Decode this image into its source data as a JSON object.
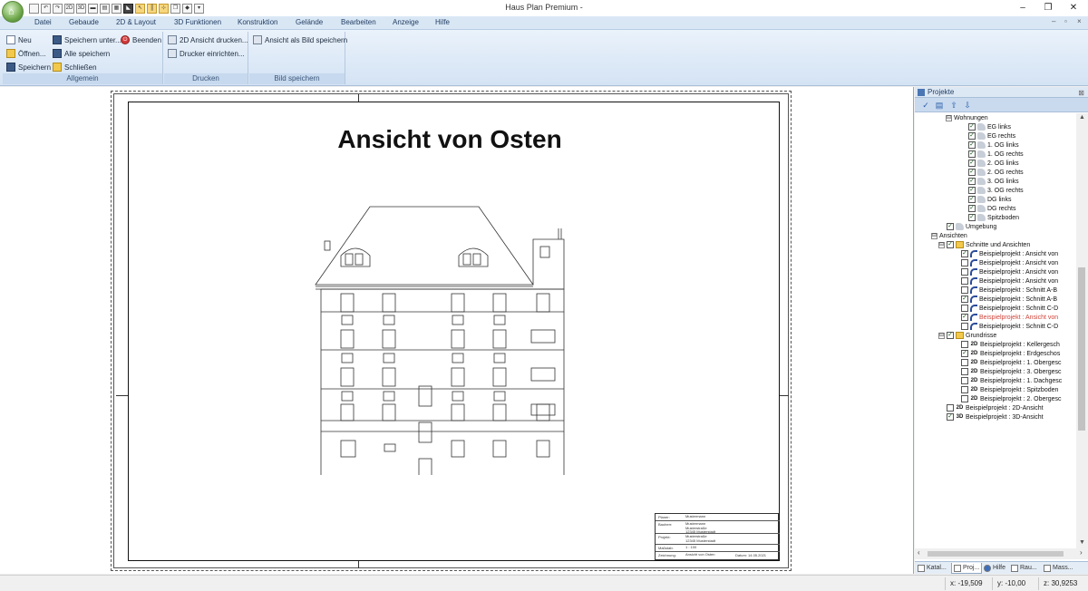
{
  "window": {
    "title": "Haus Plan Premium -",
    "buttons": {
      "minimize": "–",
      "maximize": "❐",
      "close": "✕"
    }
  },
  "quick_access": [
    "new-doc-icon",
    "undo-icon",
    "redo-icon",
    "view-2d-icon",
    "view-3d-icon",
    "wall-icon",
    "layer-icon",
    "stairs-icon",
    "roof-icon",
    "select-arrow-icon",
    "measure-icon",
    "copy-icon",
    "paint-icon",
    "dropdown-icon"
  ],
  "menu": {
    "items": [
      "Datei",
      "Gebaude",
      "2D & Layout",
      "3D Funktionen",
      "Konstruktion",
      "Gelände",
      "Bearbeiten",
      "Anzeige",
      "Hilfe"
    ],
    "mdi_buttons": [
      "–",
      "▫",
      "×"
    ]
  },
  "ribbon": {
    "groups": [
      {
        "caption": "Allgemein",
        "items": [
          "Neu",
          "Öffnen...",
          "Speichern",
          "Speichern unter...",
          "Alle speichern",
          "Schließen",
          "Beenden"
        ]
      },
      {
        "caption": "Drucken",
        "items": [
          "2D Ansicht drucken...",
          "Drucker einrichten..."
        ]
      },
      {
        "caption": "Bild speichern",
        "items": [
          "Ansicht als Bild speichern"
        ]
      }
    ]
  },
  "drawing": {
    "title": "Ansicht von Osten",
    "title_block": {
      "rows": [
        {
          "key": "Planer:",
          "value": "Mustermann",
          "value2": ""
        },
        {
          "key": "Bauherr:",
          "value": "Mustermann\nMusterstraße\n12345 Musterstadt",
          "value2": ""
        },
        {
          "key": "Projekt:",
          "value": "Musterstraße\n12345 Musterstadt",
          "value2": ""
        },
        {
          "key": "Maßstab:",
          "value": "1 : 100",
          "value2": ""
        },
        {
          "key": "Zeichnung:",
          "value": "Ansicht von Osten",
          "value2": "Datum:    14.05.2021"
        }
      ]
    }
  },
  "panel": {
    "title": "Projekte",
    "pin": "⊠",
    "tree": [
      {
        "indent": 2,
        "expander": "⊟",
        "checkbox": "",
        "icon": "",
        "label": "Wohnungen"
      },
      {
        "indent": 4,
        "expander": "",
        "checkbox": "✓",
        "icon": "room",
        "label": "EG links"
      },
      {
        "indent": 4,
        "expander": "",
        "checkbox": "✓",
        "icon": "room",
        "label": "EG rechts"
      },
      {
        "indent": 4,
        "expander": "",
        "checkbox": "✓",
        "icon": "room",
        "label": "1. OG links"
      },
      {
        "indent": 4,
        "expander": "",
        "checkbox": "✓",
        "icon": "room",
        "label": "1. OG rechts"
      },
      {
        "indent": 4,
        "expander": "",
        "checkbox": "✓",
        "icon": "room",
        "label": "2. OG links"
      },
      {
        "indent": 4,
        "expander": "",
        "checkbox": "✓",
        "icon": "room",
        "label": "2. OG rechts"
      },
      {
        "indent": 4,
        "expander": "",
        "checkbox": "✓",
        "icon": "room",
        "label": "3. OG links"
      },
      {
        "indent": 4,
        "expander": "",
        "checkbox": "✓",
        "icon": "room",
        "label": "3. OG rechts"
      },
      {
        "indent": 4,
        "expander": "",
        "checkbox": "✓",
        "icon": "room",
        "label": "DG links"
      },
      {
        "indent": 4,
        "expander": "",
        "checkbox": "✓",
        "icon": "room",
        "label": "DG rechts"
      },
      {
        "indent": 4,
        "expander": "",
        "checkbox": "✓",
        "icon": "room",
        "label": "Spitzboden"
      },
      {
        "indent": 1,
        "expander": "",
        "checkbox": "✓",
        "icon": "room",
        "label": "Umgebung"
      },
      {
        "indent": 0,
        "expander": "⊟",
        "checkbox": "",
        "icon": "",
        "label": "Ansichten"
      },
      {
        "indent": 1,
        "expander": "⊟",
        "checkbox": "✓",
        "icon": "folder",
        "label": "Schnitte und Ansichten"
      },
      {
        "indent": 3,
        "expander": "",
        "checkbox": "✓",
        "icon": "view",
        "label": "Beispielprojekt : Ansicht von"
      },
      {
        "indent": 3,
        "expander": "",
        "checkbox": "",
        "icon": "view",
        "label": "Beispielprojekt : Ansicht von"
      },
      {
        "indent": 3,
        "expander": "",
        "checkbox": "",
        "icon": "view",
        "label": "Beispielprojekt : Ansicht von"
      },
      {
        "indent": 3,
        "expander": "",
        "checkbox": "",
        "icon": "view",
        "label": "Beispielprojekt : Ansicht von"
      },
      {
        "indent": 3,
        "expander": "",
        "checkbox": "",
        "icon": "view",
        "label": "Beispielprojekt : Schnitt A-B"
      },
      {
        "indent": 3,
        "expander": "",
        "checkbox": "✓",
        "icon": "view",
        "label": "Beispielprojekt : Schnitt A-B"
      },
      {
        "indent": 3,
        "expander": "",
        "checkbox": "",
        "icon": "view",
        "label": "Beispielprojekt : Schnitt C-D"
      },
      {
        "indent": 3,
        "expander": "",
        "checkbox": "✓",
        "icon": "view",
        "label": "Beispielprojekt : Ansicht von",
        "highlight": true
      },
      {
        "indent": 3,
        "expander": "",
        "checkbox": "",
        "icon": "view",
        "label": "Beispielprojekt : Schnitt C-D"
      },
      {
        "indent": 1,
        "expander": "⊟",
        "checkbox": "✓",
        "icon": "folder",
        "label": "Grundrisse"
      },
      {
        "indent": 3,
        "expander": "",
        "checkbox": "",
        "icon": "2D",
        "label": "Beispielprojekt : Kellergesch"
      },
      {
        "indent": 3,
        "expander": "",
        "checkbox": "✓",
        "icon": "2D",
        "label": "Beispielprojekt : Erdgeschos"
      },
      {
        "indent": 3,
        "expander": "",
        "checkbox": "",
        "icon": "2D",
        "label": "Beispielprojekt : 1. Obergesc"
      },
      {
        "indent": 3,
        "expander": "",
        "checkbox": "",
        "icon": "2D",
        "label": "Beispielprojekt : 3. Obergesc"
      },
      {
        "indent": 3,
        "expander": "",
        "checkbox": "",
        "icon": "2D",
        "label": "Beispielprojekt : 1. Dachgesc"
      },
      {
        "indent": 3,
        "expander": "",
        "checkbox": "",
        "icon": "2D",
        "label": "Beispielprojekt : Spitzboden"
      },
      {
        "indent": 3,
        "expander": "",
        "checkbox": "",
        "icon": "2D",
        "label": "Beispielprojekt : 2. Obergesc"
      },
      {
        "indent": 1,
        "expander": "",
        "checkbox": "",
        "icon": "2D",
        "label": "Beispielprojekt : 2D-Ansicht"
      },
      {
        "indent": 1,
        "expander": "",
        "checkbox": "✓",
        "icon": "3D",
        "label": "Beispielprojekt : 3D-Ansicht"
      }
    ],
    "tabs": [
      "Katal...",
      "Proj...",
      "Hilfe",
      "Rau...",
      "Mass..."
    ],
    "active_tab": 1
  },
  "status": {
    "x": "x: -19,509",
    "y": "y: -10,00",
    "z": "z: 30,9253"
  },
  "colors": {
    "ribbon_bg": "#d4e3f4",
    "highlight_text": "#d0443a",
    "accent": "#2a5fa8"
  }
}
